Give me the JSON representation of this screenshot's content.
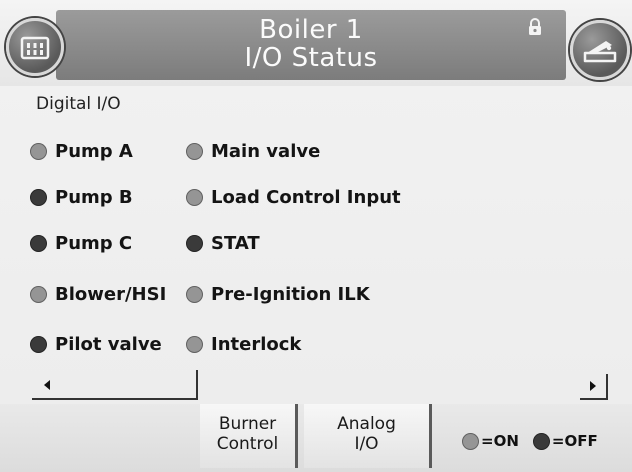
{
  "header": {
    "title_line1": "Boiler 1",
    "title_line2": "I/O Status"
  },
  "section_label": "Digital I/O",
  "colors": {
    "on": "#959595",
    "off": "#3a3a3a",
    "title_band": "#8c8c8c"
  },
  "io_left": [
    {
      "label": "Pump A",
      "state": "on"
    },
    {
      "label": "Pump B",
      "state": "off"
    },
    {
      "label": "Pump C",
      "state": "off"
    },
    {
      "label": "Blower/HSI",
      "state": "on"
    },
    {
      "label": "Pilot valve",
      "state": "off"
    }
  ],
  "io_right": [
    {
      "label": "Main valve",
      "state": "on"
    },
    {
      "label": "Load Control Input",
      "state": "on"
    },
    {
      "label": "STAT",
      "state": "off"
    },
    {
      "label": "Pre-Ignition ILK",
      "state": "on"
    },
    {
      "label": "Interlock",
      "state": "on"
    }
  ],
  "footer": {
    "burner_control": {
      "line1": "Burner",
      "line2": "Control"
    },
    "analog_io": {
      "line1": "Analog",
      "line2": "I/O"
    },
    "legend_on": "=ON",
    "legend_off": "=OFF"
  },
  "icons": {
    "home": "building-icon",
    "right": "burner-icon",
    "lock": "lock-icon"
  }
}
